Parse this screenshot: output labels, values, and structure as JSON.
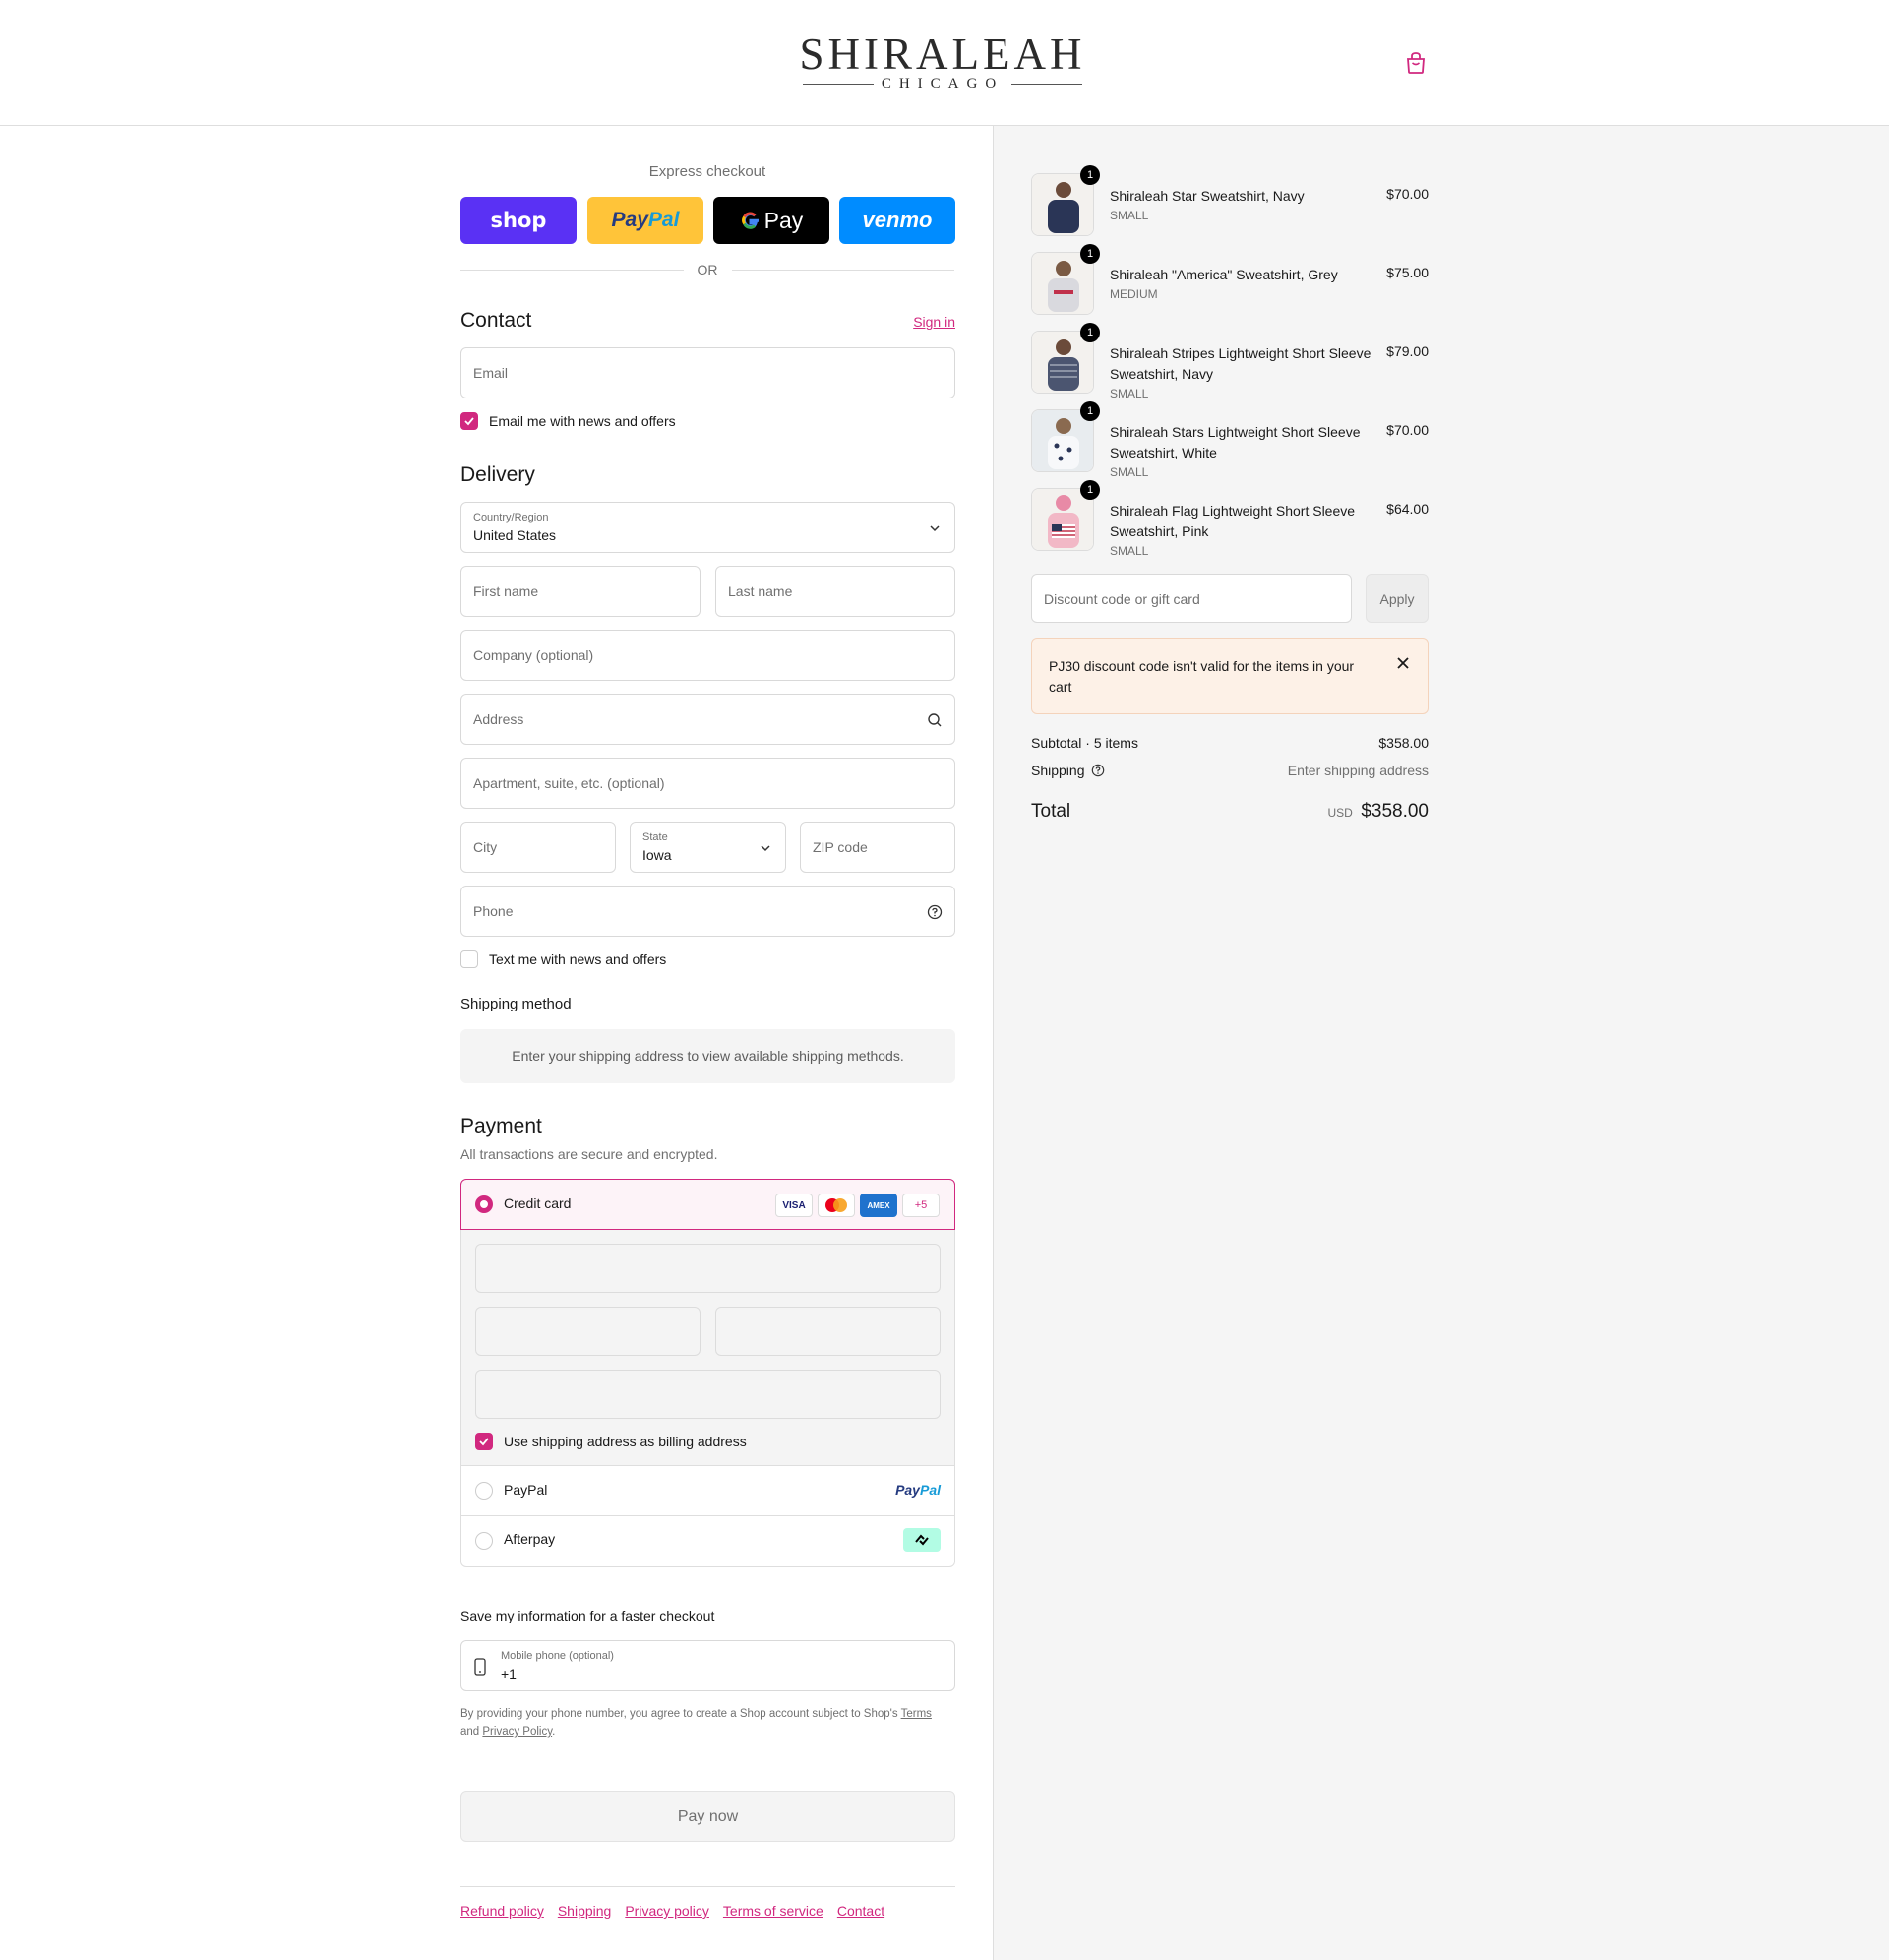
{
  "header": {
    "logo_main": "SHIRALEAH",
    "logo_sub": "CHICAGO"
  },
  "express": {
    "label": "Express checkout",
    "shop": "shop",
    "paypal_a": "Pay",
    "paypal_b": "Pal",
    "gpay": "Pay",
    "venmo": "venmo",
    "or": "OR"
  },
  "contact": {
    "title": "Contact",
    "sign_in": "Sign in",
    "email_placeholder": "Email",
    "email_news": "Email me with news and offers"
  },
  "delivery": {
    "title": "Delivery",
    "country_label": "Country/Region",
    "country_value": "United States",
    "first_name": "First name",
    "last_name": "Last name",
    "company": "Company (optional)",
    "address": "Address",
    "apartment": "Apartment, suite, etc. (optional)",
    "city": "City",
    "state_label": "State",
    "state_value": "Iowa",
    "zip": "ZIP code",
    "phone": "Phone",
    "text_news": "Text me with news and offers"
  },
  "shipping": {
    "title": "Shipping method",
    "message": "Enter your shipping address to view available shipping methods."
  },
  "payment": {
    "title": "Payment",
    "subtitle": "All transactions are secure and encrypted.",
    "credit_card": "Credit card",
    "badges": [
      "VISA",
      "AMEX",
      "+5"
    ],
    "billing_same": "Use shipping address as billing address",
    "paypal": "PayPal",
    "paypal_logo_a": "Pay",
    "paypal_logo_b": "Pal",
    "afterpay": "Afterpay"
  },
  "save": {
    "title": "Save my information for a faster checkout",
    "mobile_label": "Mobile phone (optional)",
    "mobile_value": "+1",
    "legal_1": "By providing your phone number, you agree to create a Shop account subject to Shop's",
    "terms": "Terms",
    "and": "and",
    "privacy": "Privacy Policy",
    "period": "."
  },
  "pay_now": "Pay now",
  "footer": [
    "Refund policy",
    "Shipping",
    "Privacy policy",
    "Terms of service",
    "Contact"
  ],
  "cart": {
    "items": [
      {
        "qty": "1",
        "name": "Shiraleah Star Sweatshirt, Navy",
        "variant": "SMALL",
        "price": "$70.00",
        "color": "#2a3556"
      },
      {
        "qty": "1",
        "name": "Shiraleah \"America\" Sweatshirt, Grey",
        "variant": "MEDIUM",
        "price": "$75.00",
        "color": "#d9d9de"
      },
      {
        "qty": "1",
        "name": "Shiraleah Stripes Lightweight Short Sleeve Sweatshirt, Navy",
        "variant": "SMALL",
        "price": "$79.00",
        "color": "#4b5570"
      },
      {
        "qty": "1",
        "name": "Shiraleah Stars Lightweight Short Sleeve Sweatshirt, White",
        "variant": "SMALL",
        "price": "$70.00",
        "color": "#eef0f4"
      },
      {
        "qty": "1",
        "name": "Shiraleah Flag Lightweight Short Sleeve Sweatshirt, Pink",
        "variant": "SMALL",
        "price": "$64.00",
        "color": "#f2b8c6"
      }
    ],
    "discount_placeholder": "Discount code or gift card",
    "apply": "Apply",
    "alert": "PJ30 discount code isn't valid for the items in your cart",
    "subtotal_label": "Subtotal · 5 items",
    "subtotal_value": "$358.00",
    "shipping_label": "Shipping",
    "shipping_value": "Enter shipping address",
    "total_label": "Total",
    "currency": "USD",
    "total_value": "$358.00"
  },
  "colors": {
    "accent": "#d1287f",
    "shop": "#5a31f4",
    "paypal": "#ffc439",
    "venmo": "#008cff"
  }
}
